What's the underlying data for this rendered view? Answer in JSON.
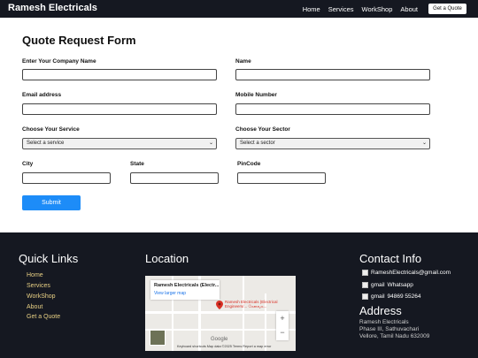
{
  "nav": {
    "brand": "Ramesh Electricals",
    "links": [
      "Home",
      "Services",
      "WorkShop",
      "About"
    ],
    "cta": "Get a Quote"
  },
  "form": {
    "title": "Quote Request Form",
    "company_label": "Enter Your Company Name",
    "name_label": "Name",
    "email_label": "Email address",
    "mobile_label": "Mobile Number",
    "service_label": "Choose Your Service",
    "service_value": "Select a service",
    "sector_label": "Choose Your Sector",
    "sector_value": "Select a sector",
    "city_label": "City",
    "state_label": "State",
    "pincode_label": "PinCode",
    "submit": "Submit"
  },
  "footer": {
    "quick_links_title": "Quick Links",
    "quick_links": [
      "Home",
      "Services",
      "WorkShop",
      "About",
      "Get a Quote"
    ],
    "location_title": "Location",
    "map": {
      "place": "Ramesh Electricals (Electr...",
      "larger_map": "View larger map",
      "pin_label": "Ramesh Electricals (Electrical Engineers/... சேவைக...",
      "attribution": "Keyboard shortcuts   Map data ©2025   Terms   Report a map error",
      "logo": "Google"
    },
    "contact_title": "Contact Info",
    "email": "RameshElectricals@gmail.com",
    "whatsapp": "Whatsapp",
    "phone": "94869 55264",
    "gmail_alt": "gmail",
    "address_title": "Address",
    "address_lines": [
      "Ramesh Electricals",
      "Phase III, Sathuvachari",
      "Vellore, Tamil Nadu 632009"
    ]
  }
}
